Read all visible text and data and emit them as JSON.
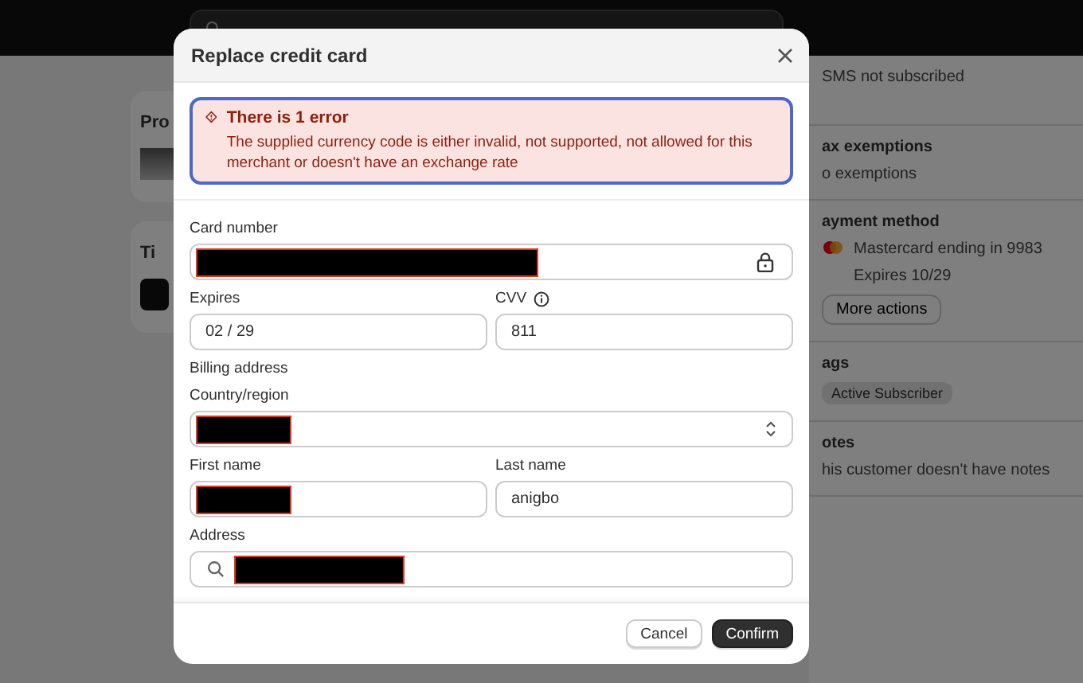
{
  "background": {
    "left_cards": [
      {
        "title": "Pro",
        "kind": "thumb"
      },
      {
        "title": "Ti",
        "kind": "logo"
      }
    ],
    "right_sections": [
      {
        "lines": [
          "SMS not subscribed"
        ]
      },
      {
        "title": "ax exemptions",
        "lines": [
          "o exemptions"
        ]
      },
      {
        "title": "ayment method",
        "kind": "card",
        "lines": [
          "Mastercard ending in 9983",
          "Expires 10/29"
        ],
        "button": "More actions"
      },
      {
        "title": "ags",
        "tag": "Active Subscriber"
      },
      {
        "title": "otes",
        "lines": [
          "his customer doesn't have notes"
        ]
      }
    ]
  },
  "dialog": {
    "title": "Replace credit card",
    "error": {
      "title": "There is 1 error",
      "message": "The supplied currency code is either invalid, not supported, not allowed for this merchant or doesn't have an exchange rate"
    },
    "card_number": {
      "label": "Card number",
      "redacted": true
    },
    "expires": {
      "label": "Expires",
      "value": "02 / 29"
    },
    "cvv": {
      "label": "CVV",
      "value": "811"
    },
    "billing_heading": "Billing address",
    "country": {
      "label": "Country/region",
      "redacted": true
    },
    "first_name": {
      "label": "First name",
      "redacted": true
    },
    "last_name": {
      "label": "Last name",
      "value": "anigbo"
    },
    "address": {
      "label": "Address",
      "redacted": true
    },
    "buttons": [
      {
        "label": "Cancel",
        "kind": "secondary"
      },
      {
        "label": "Confirm",
        "kind": "primary"
      }
    ]
  }
}
